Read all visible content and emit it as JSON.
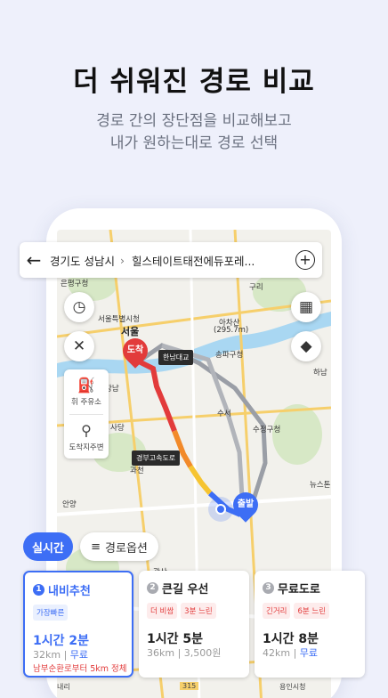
{
  "headline": "더 쉬워진 경로 비교",
  "subline1": "경로 간의 장단점을 비교해보고",
  "subline2": "내가 원하는대로 경로 선택",
  "search": {
    "origin": "경기도 성남시",
    "destination": "힐스테이트태전에듀포레...",
    "back_icon": "arrow-left-icon",
    "add_icon": "plus-circle-icon"
  },
  "map_buttons": {
    "history_icon": "clock-icon",
    "close_icon": "close-icon",
    "grid_icon": "grid-icon",
    "layers_icon": "layers-icon"
  },
  "side_panel": {
    "gas_label": "주유소",
    "gas_prefix": "휘",
    "via_label": "도착지주변"
  },
  "map_labels": {
    "seoul": "서울",
    "city_hall": "서울특별시청",
    "achasan": "아차산",
    "achasan_height": "(295.7m)",
    "guri": "구리",
    "hanam": "하남",
    "sadang": "사당",
    "gwacheon": "과천",
    "anyang": "안양",
    "eunpyeong": "은평구청",
    "gwangjin": "광진구청",
    "songpa": "송파구청",
    "suseo": "수서",
    "sujeong": "수정구청",
    "newstone": "뉴스톤",
    "gangnam": "강남",
    "gwaksan": "광산",
    "gyeongbu_tag": "경부고속도로",
    "hannam_tag": "한남대교",
    "arrive_pin": "도착",
    "depart_pin": "출발"
  },
  "chips": {
    "realtime": "실시간",
    "route_options": "경로옵션",
    "options_icon": "sliders-icon"
  },
  "routes": [
    {
      "num": "1",
      "title": "내비추천",
      "badges": [
        {
          "text": "가장빠른",
          "style": "blue"
        }
      ],
      "time": "1시간 2분",
      "distance": "32km",
      "toll": "무료",
      "jam": "남부순환로부터 5km 정체"
    },
    {
      "num": "2",
      "title": "큰길 우선",
      "badges": [
        {
          "text": "더 비쌈",
          "style": "red"
        },
        {
          "text": "3분 느린",
          "style": "red"
        }
      ],
      "time": "1시간 5분",
      "distance": "36km",
      "toll": "3,500원"
    },
    {
      "num": "3",
      "title": "무료도로",
      "badges": [
        {
          "text": "긴거리",
          "style": "red"
        },
        {
          "text": "6분 느린",
          "style": "red"
        }
      ],
      "time": "1시간 8분",
      "distance": "42km",
      "toll": "무료"
    }
  ],
  "bottom_labels": {
    "naeri": "내리",
    "road_number": "315",
    "yongin": "용인시청"
  },
  "colors": {
    "accent": "#3d6ef5",
    "warning": "#e23b3b",
    "background": "#eef0fb"
  }
}
